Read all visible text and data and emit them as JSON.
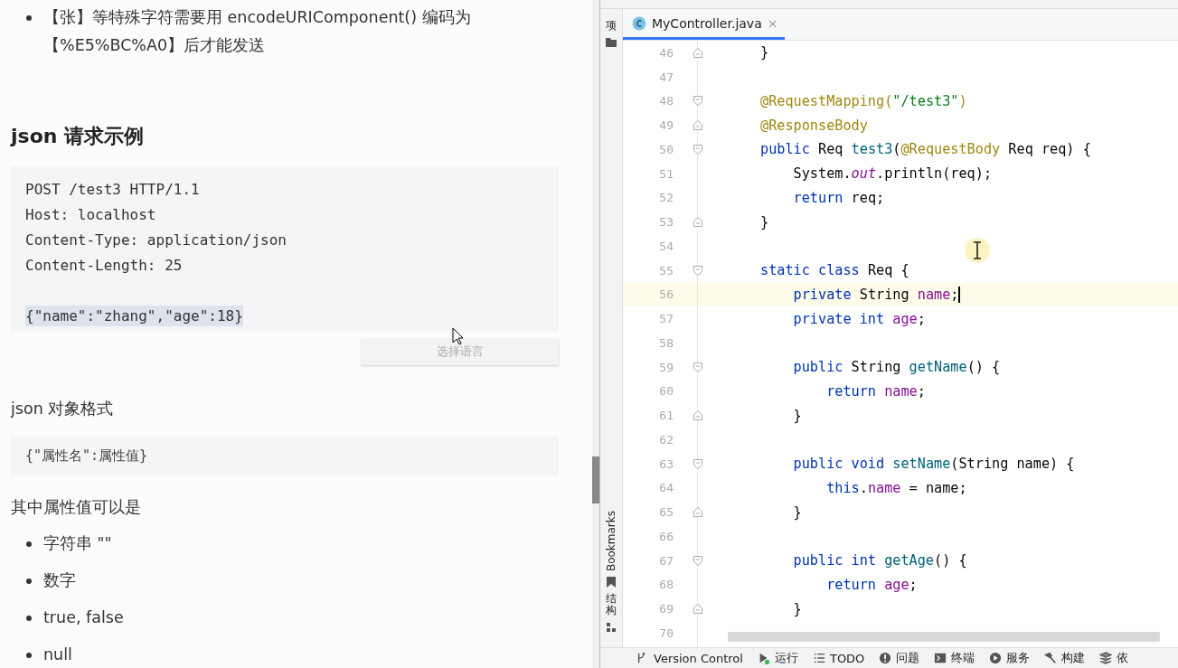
{
  "doc": {
    "bullet": "【张】等特殊字符需要用 encodeURIComponent() 编码为【%E5%BC%A0】后才能发送",
    "heading": "json 请求示例",
    "request_lines": [
      {
        "kind": "text",
        "text": "POST /test3 HTTP/1.1",
        "selected": false
      },
      {
        "kind": "text",
        "text": "Host: localhost",
        "selected": false
      },
      {
        "kind": "text",
        "text": "Content-Type: application/json",
        "selected": false
      },
      {
        "kind": "text",
        "text": "Content-Length: 25",
        "selected": false
      },
      {
        "kind": "blank"
      },
      {
        "kind": "text",
        "text": "{\"name\":\"zhang\",\"age\":18}",
        "selected": true
      }
    ],
    "language_button": "选择语言",
    "paragraph": "json 对象格式",
    "format_block": "{\"属性名\":属性值}",
    "values_intro": "其中属性值可以是",
    "values": [
      "字符串 \"\"",
      "数字",
      "true, false",
      "null"
    ]
  },
  "ide": {
    "tab": {
      "label": "MyController.java",
      "close": "×",
      "selected": true
    },
    "side_tools": [
      {
        "label": "项",
        "kind": "cjk"
      },
      {
        "label": "Bookmarks",
        "kind": "latin"
      },
      {
        "label": "结构",
        "kind": "cjk"
      }
    ],
    "code_lines": [
      {
        "number": "46",
        "fold": {
          "kind": "end"
        },
        "current": false,
        "tokens": [
          {
            "text": "}",
            "kind": "plain"
          }
        ]
      },
      {
        "number": "47",
        "current": false
      },
      {
        "number": "48",
        "fold": {
          "kind": "start"
        },
        "current": false,
        "tokens": [
          {
            "text": "@RequestMapping(",
            "kind": "annotation"
          },
          {
            "text": "\"/test3\"",
            "kind": "string"
          },
          {
            "text": ")",
            "kind": "annotation"
          }
        ]
      },
      {
        "number": "49",
        "fold": {
          "kind": "end"
        },
        "current": false,
        "tokens": [
          {
            "text": "@ResponseBody",
            "kind": "annotation"
          }
        ]
      },
      {
        "number": "50",
        "fold": {
          "kind": "start"
        },
        "current": false,
        "tokens": [
          {
            "text": "public ",
            "kind": "keyword"
          },
          {
            "text": "Req ",
            "kind": "plain"
          },
          {
            "text": "test3",
            "kind": "method"
          },
          {
            "text": "(",
            "kind": "plain"
          },
          {
            "text": "@RequestBody ",
            "kind": "annotation"
          },
          {
            "text": "Req req) {",
            "kind": "plain"
          }
        ]
      },
      {
        "number": "51",
        "current": false,
        "tokens": [
          {
            "text": "    System.",
            "kind": "plain"
          },
          {
            "text": "out",
            "kind": "static"
          },
          {
            "text": ".println(req);",
            "kind": "plain"
          }
        ]
      },
      {
        "number": "52",
        "current": false,
        "tokens": [
          {
            "text": "    return ",
            "kind": "keyword"
          },
          {
            "text": "req;",
            "kind": "plain"
          }
        ]
      },
      {
        "number": "53",
        "fold": {
          "kind": "end"
        },
        "current": false,
        "tokens": [
          {
            "text": "}",
            "kind": "plain"
          }
        ]
      },
      {
        "number": "54",
        "current": false
      },
      {
        "number": "55",
        "fold": {
          "kind": "start"
        },
        "current": false,
        "tokens": [
          {
            "text": "static class ",
            "kind": "keyword"
          },
          {
            "text": "Req {",
            "kind": "plain"
          }
        ]
      },
      {
        "number": "56",
        "current": true,
        "tokens": [
          {
            "text": "    private ",
            "kind": "keyword"
          },
          {
            "text": "String ",
            "kind": "plain"
          },
          {
            "text": "name",
            "kind": "field"
          },
          {
            "text": ";",
            "kind": "plain"
          }
        ]
      },
      {
        "number": "57",
        "current": false,
        "tokens": [
          {
            "text": "    private int ",
            "kind": "keyword"
          },
          {
            "text": "age",
            "kind": "field"
          },
          {
            "text": ";",
            "kind": "plain"
          }
        ]
      },
      {
        "number": "58",
        "current": false
      },
      {
        "number": "59",
        "fold": {
          "kind": "start"
        },
        "current": false,
        "tokens": [
          {
            "text": "    public ",
            "kind": "keyword"
          },
          {
            "text": "String ",
            "kind": "plain"
          },
          {
            "text": "getName",
            "kind": "method"
          },
          {
            "text": "() {",
            "kind": "plain"
          }
        ]
      },
      {
        "number": "60",
        "current": false,
        "tokens": [
          {
            "text": "        return ",
            "kind": "keyword"
          },
          {
            "text": "name",
            "kind": "field"
          },
          {
            "text": ";",
            "kind": "plain"
          }
        ]
      },
      {
        "number": "61",
        "fold": {
          "kind": "end"
        },
        "current": false,
        "tokens": [
          {
            "text": "    }",
            "kind": "plain"
          }
        ]
      },
      {
        "number": "62",
        "current": false
      },
      {
        "number": "63",
        "fold": {
          "kind": "start"
        },
        "current": false,
        "tokens": [
          {
            "text": "    public void ",
            "kind": "keyword"
          },
          {
            "text": "setName",
            "kind": "method"
          },
          {
            "text": "(String name) {",
            "kind": "plain"
          }
        ]
      },
      {
        "number": "64",
        "current": false,
        "tokens": [
          {
            "text": "        this",
            "kind": "keyword"
          },
          {
            "text": ".",
            "kind": "plain"
          },
          {
            "text": "name",
            "kind": "field"
          },
          {
            "text": " = name;",
            "kind": "plain"
          }
        ]
      },
      {
        "number": "65",
        "fold": {
          "kind": "end"
        },
        "current": false,
        "tokens": [
          {
            "text": "    }",
            "kind": "plain"
          }
        ]
      },
      {
        "number": "66",
        "current": false
      },
      {
        "number": "67",
        "fold": {
          "kind": "start"
        },
        "current": false,
        "tokens": [
          {
            "text": "    public int ",
            "kind": "keyword"
          },
          {
            "text": "getAge",
            "kind": "method"
          },
          {
            "text": "() {",
            "kind": "plain"
          }
        ]
      },
      {
        "number": "68",
        "current": false,
        "tokens": [
          {
            "text": "        return ",
            "kind": "keyword"
          },
          {
            "text": "age",
            "kind": "field"
          },
          {
            "text": ";",
            "kind": "plain"
          }
        ]
      },
      {
        "number": "69",
        "fold": {
          "kind": "end"
        },
        "current": false,
        "tokens": [
          {
            "text": "    }",
            "kind": "plain"
          }
        ]
      },
      {
        "number": "70",
        "current": false
      }
    ],
    "bottom_tools": [
      "Version Control",
      "运行",
      "TODO",
      "问题",
      "终端",
      "服务",
      "构建",
      "依"
    ]
  }
}
